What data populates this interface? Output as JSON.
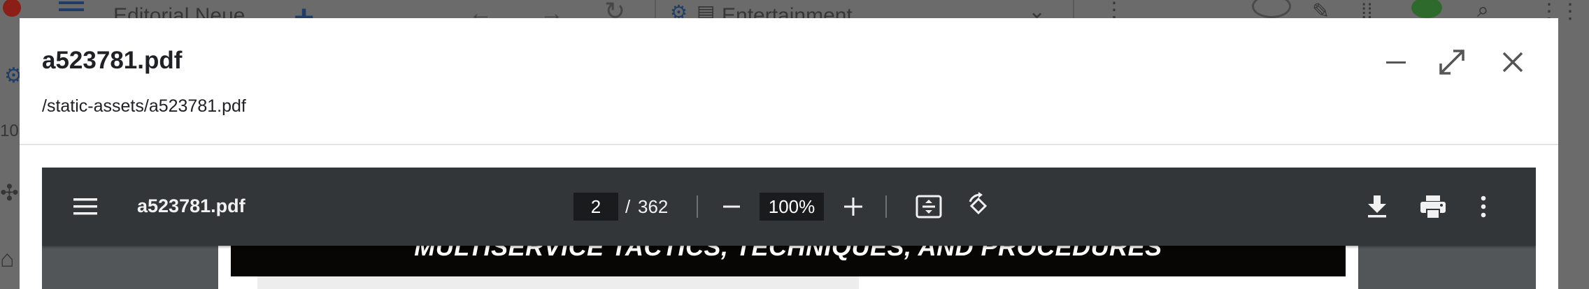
{
  "background_app": {
    "workspace_label": "Editorial Neue",
    "tab_label": "Entertainment",
    "left_partial_text": "10"
  },
  "modal": {
    "title": "a523781.pdf",
    "path": "/static-assets/a523781.pdf"
  },
  "pdf_viewer": {
    "title": "a523781.pdf",
    "current_page": "2",
    "page_separator": "/",
    "total_pages": "362",
    "zoom": "100%"
  },
  "document": {
    "banner_text": "MULTISERVICE TACTICS, TECHNIQUES, AND PROCEDURES"
  },
  "colors": {
    "toolbar": "#323639",
    "viewer_background": "#525659",
    "overlay": "#6d6d6d",
    "brand_blue": "#1f3d66"
  },
  "icons": {
    "modal": [
      "minimize-icon",
      "maximize-icon",
      "close-icon"
    ],
    "toolbar": [
      "menu-icon",
      "zoom-out-icon",
      "zoom-in-icon",
      "fit-page-icon",
      "rotate-icon",
      "download-icon",
      "print-icon",
      "more-vert-icon"
    ]
  }
}
